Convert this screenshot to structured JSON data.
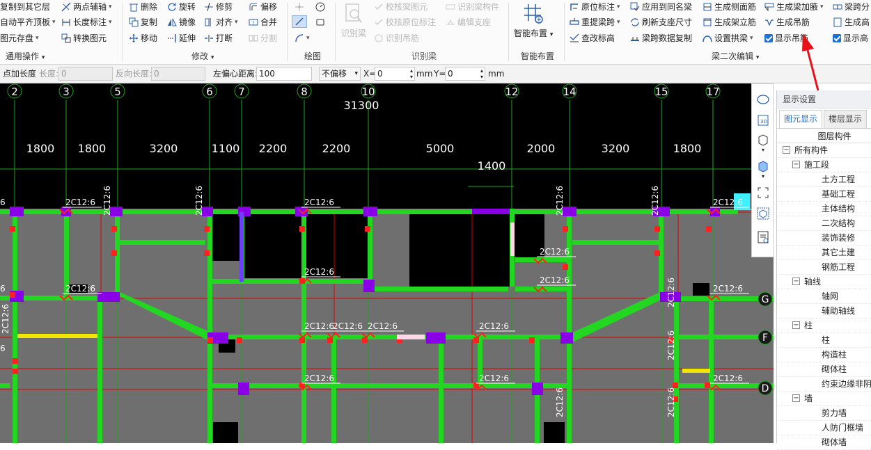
{
  "ribbon": {
    "general": {
      "copy_to_layer": "复制到其它层",
      "auto_flat_slab": "自动平齐顶板",
      "element_save": "图元存盘",
      "two_point_axis": "两点辅轴",
      "length_mark": "长度标注",
      "convert_element": "转换图元",
      "footer": "通用操作"
    },
    "modify": {
      "delete": "删除",
      "copy": "复制",
      "move": "移动",
      "rotate": "旋转",
      "mirror": "镜像",
      "extend": "延伸",
      "trim": "修剪",
      "align": "对齐",
      "break": "打断",
      "offset": "偏移",
      "merge": "合并",
      "split": "分割",
      "footer": "修改"
    },
    "draw": {
      "footer": "绘图"
    },
    "identify_beam": {
      "identify_beam": "识别梁",
      "check_beam_elements": "校核梁图元",
      "check_original_marks": "校核原位标注",
      "identify_hanging_bars": "识别吊筋",
      "identify_beam_members": "识别梁构件",
      "edit_support": "编辑支座",
      "footer": "识别梁"
    },
    "smart": {
      "smart_layout": "智能布置",
      "footer": "智能布置"
    },
    "beam_edit": {
      "in_place_mark": "原位标注",
      "relift_span": "重提梁跨",
      "check_elevation": "查改标高",
      "apply_same_name": "应用到同名梁",
      "refresh_support_size": "刷新支座尺寸",
      "copy_span_data": "梁跨数据复制",
      "gen_side_bars": "生成侧面筋",
      "gen_stirrup_bars": "生成架立筋",
      "set_arch_beam": "设置拱梁",
      "gen_haunch": "生成梁加腋",
      "gen_hanger": "生成吊筋",
      "show_hanger": "显示吊筋",
      "span_split": "梁跨分",
      "gen_high": "生成高",
      "show_high": "显示高",
      "footer": "梁二次编辑"
    }
  },
  "optbar": {
    "point_add_length": "点加长度",
    "length_label": "长度:",
    "length_value": "0",
    "reverse_length_label": "反向长度:",
    "reverse_length_value": "0",
    "left_offset_label": "左偏心距离:",
    "left_offset_value": "100",
    "offset_mode": "不偏移",
    "x_label": "X=",
    "x_value": "0",
    "mm1": "mm",
    "y_label": "Y=",
    "y_value": "0",
    "mm2": "mm"
  },
  "canvas": {
    "axis_numbers": [
      "2",
      "3",
      "5",
      "6",
      "7",
      "8",
      "10",
      "12",
      "14",
      "15",
      "17"
    ],
    "row_labels": [
      "G",
      "F",
      "D"
    ],
    "total_dim": "31300",
    "dims": [
      "1800",
      "1800",
      "3200",
      "1100",
      "2200",
      "2200",
      "5000",
      "2000",
      "3200",
      "1800"
    ],
    "dim_1400": "1400",
    "beam_label": "2C12:6",
    "edge_label": "6"
  },
  "panel": {
    "title": "显示设置",
    "tab_element": "图元显示",
    "tab_floor": "楼层显示",
    "column_header": "图层构件",
    "tree": [
      {
        "level": 0,
        "toggle": "−",
        "label": "所有构件"
      },
      {
        "level": 1,
        "toggle": "−",
        "label": "施工段"
      },
      {
        "level": 2,
        "label": "土方工程"
      },
      {
        "level": 2,
        "label": "基础工程"
      },
      {
        "level": 2,
        "label": "主体结构"
      },
      {
        "level": 2,
        "label": "二次结构"
      },
      {
        "level": 2,
        "label": "装饰装修"
      },
      {
        "level": 2,
        "label": "其它土建"
      },
      {
        "level": 2,
        "label": "钢筋工程"
      },
      {
        "level": 1,
        "toggle": "−",
        "label": "轴线"
      },
      {
        "level": 2,
        "label": "轴网"
      },
      {
        "level": 2,
        "label": "辅助轴线"
      },
      {
        "level": 1,
        "toggle": "−",
        "label": "柱"
      },
      {
        "level": 2,
        "label": "柱"
      },
      {
        "level": 2,
        "label": "构造柱"
      },
      {
        "level": 2,
        "label": "砌体柱"
      },
      {
        "level": 2,
        "label": "约束边缘非阴..."
      },
      {
        "level": 1,
        "toggle": "−",
        "label": "墙"
      },
      {
        "level": 2,
        "label": "剪力墙"
      },
      {
        "level": 2,
        "label": "人防门框墙"
      },
      {
        "level": 2,
        "label": "砌体墙"
      }
    ]
  },
  "colors": {
    "beam": "#22d622",
    "column": "#8a00e6",
    "axis": "#e00000",
    "slab_gray": "#6f6f6f",
    "grid_green": "#1fa51f",
    "annot_red": "#ff2020",
    "arrow": "#e8101a",
    "accent": "#1e6fd6"
  }
}
